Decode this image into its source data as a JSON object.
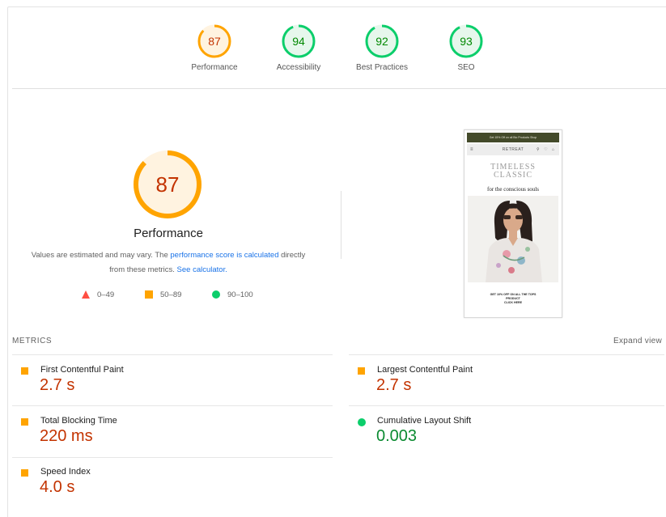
{
  "summary": [
    {
      "score": "87",
      "label": "Performance",
      "color": "#ffa400",
      "ring": "#fff3e0",
      "text": "#c33300",
      "fraction": 0.87
    },
    {
      "score": "94",
      "label": "Accessibility",
      "color": "#0cce6b",
      "ring": "#e6f7ec",
      "text": "#008800",
      "fraction": 0.94
    },
    {
      "score": "92",
      "label": "Best Practices",
      "color": "#0cce6b",
      "ring": "#e6f7ec",
      "text": "#008800",
      "fraction": 0.92
    },
    {
      "score": "93",
      "label": "SEO",
      "color": "#0cce6b",
      "ring": "#e6f7ec",
      "text": "#008800",
      "fraction": 0.93
    }
  ],
  "main": {
    "score": "87",
    "fraction": 0.87,
    "title": "Performance",
    "desc_prefix": "Values are estimated and may vary. The ",
    "desc_link1": "performance score is calculated",
    "desc_middle": " directly from these metrics. ",
    "desc_link2": "See calculator.",
    "legend": [
      {
        "range": "0–49",
        "shape": "triangle",
        "color": "#ff4e42"
      },
      {
        "range": "50–89",
        "shape": "square",
        "color": "#ffa400"
      },
      {
        "range": "90–100",
        "shape": "circle",
        "color": "#0cce6b"
      }
    ]
  },
  "screenshot": {
    "banner": "Get 15% Off on all Bio Products  Shop",
    "menu_icon": "≡",
    "brand": "RETREAT",
    "nav_icons": "⚲ ♡ ⌂",
    "heading_line1": "TIMELESS",
    "heading_line2": "CLASSIC",
    "subheading": "for the conscious souls",
    "cta_line1": "GET 10% OFF ON ALL THE TOPS",
    "cta_line2": "PRODUCT",
    "cta_line3": "CLICK HERE"
  },
  "metrics": {
    "heading": "METRICS",
    "expand_label": "Expand view",
    "items": [
      {
        "name": "First Contentful Paint",
        "value": "2.7 s",
        "status": "orange"
      },
      {
        "name": "Largest Contentful Paint",
        "value": "2.7 s",
        "status": "orange"
      },
      {
        "name": "Total Blocking Time",
        "value": "220 ms",
        "status": "orange"
      },
      {
        "name": "Cumulative Layout Shift",
        "value": "0.003",
        "status": "green"
      },
      {
        "name": "Speed Index",
        "value": "4.0 s",
        "status": "orange"
      }
    ]
  },
  "colors": {
    "orange": "#ffa400",
    "green": "#0cce6b",
    "red": "#ff4e42",
    "link": "#1a73e8"
  }
}
